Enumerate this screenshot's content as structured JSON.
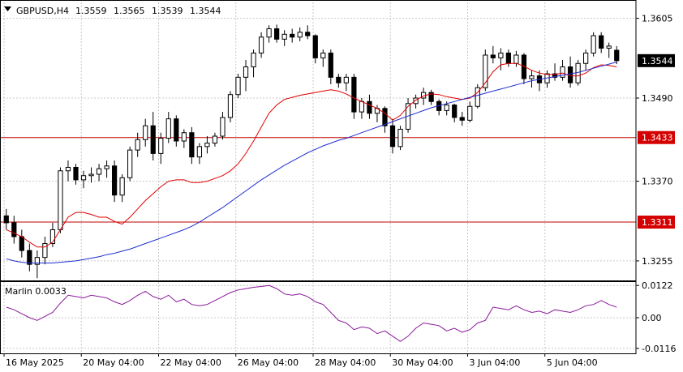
{
  "header": {
    "symbol": "GBPUSD,H4",
    "open": "1.3559",
    "high": "1.3565",
    "low": "1.3539",
    "close": "1.3544"
  },
  "indicator": {
    "label": "Marlin 0.0033"
  },
  "colors": {
    "grid": "#c8c8c8",
    "frame": "#000000",
    "ma_fast": "#e00000",
    "ma_slow": "#1f2fd0",
    "level": "#c00000",
    "oscillator": "#8b1a9b",
    "price_badge": "#000000",
    "level_badge": "#d40000"
  },
  "chart_data": [
    {
      "type": "candlestick",
      "symbol": "GBPUSD",
      "timeframe": "H4",
      "ylim": [
        1.3228,
        1.3628
      ],
      "yticks": [
        "1.3605",
        "1.3490",
        "1.3370",
        "1.3255"
      ],
      "xticks": [
        "16 May 2025",
        "20 May 04:00",
        "22 May 04:00",
        "26 May 04:00",
        "28 May 04:00",
        "30 May 04:00",
        "3 Jun 04:00",
        "5 Jun 04:00"
      ],
      "grid": true,
      "current_price": "1.3544",
      "horizontal_levels": [
        "1.3433",
        "1.3311"
      ],
      "candles": [
        [
          1.332,
          1.333,
          1.33,
          1.331
        ],
        [
          1.331,
          1.332,
          1.328,
          1.329
        ],
        [
          1.329,
          1.33,
          1.326,
          1.327
        ],
        [
          1.327,
          1.328,
          1.324,
          1.325
        ],
        [
          1.325,
          1.327,
          1.323,
          1.326
        ],
        [
          1.326,
          1.329,
          1.325,
          1.328
        ],
        [
          1.328,
          1.331,
          1.3275,
          1.33
        ],
        [
          1.33,
          1.339,
          1.3295,
          1.3385
        ],
        [
          1.3385,
          1.34,
          1.337,
          1.339
        ],
        [
          1.339,
          1.3395,
          1.3365,
          1.3372
        ],
        [
          1.3372,
          1.3385,
          1.336,
          1.3378
        ],
        [
          1.3378,
          1.339,
          1.3368,
          1.338
        ],
        [
          1.338,
          1.3395,
          1.337,
          1.3388
        ],
        [
          1.3388,
          1.34,
          1.3375,
          1.3392
        ],
        [
          1.3392,
          1.34,
          1.334,
          1.335
        ],
        [
          1.335,
          1.338,
          1.334,
          1.3375
        ],
        [
          1.3375,
          1.342,
          1.337,
          1.3415
        ],
        [
          1.3415,
          1.344,
          1.3405,
          1.343
        ],
        [
          1.343,
          1.346,
          1.342,
          1.345
        ],
        [
          1.345,
          1.347,
          1.34,
          1.341
        ],
        [
          1.341,
          1.344,
          1.3395,
          1.3432
        ],
        [
          1.3432,
          1.347,
          1.3425,
          1.346
        ],
        [
          1.346,
          1.3465,
          1.342,
          1.3428
        ],
        [
          1.3428,
          1.3445,
          1.3418,
          1.344
        ],
        [
          1.344,
          1.3448,
          1.3395,
          1.3405
        ],
        [
          1.3405,
          1.3425,
          1.3395,
          1.342
        ],
        [
          1.342,
          1.3435,
          1.341,
          1.3425
        ],
        [
          1.3425,
          1.344,
          1.342,
          1.3435
        ],
        [
          1.3435,
          1.347,
          1.343,
          1.3462
        ],
        [
          1.3462,
          1.35,
          1.3455,
          1.3495
        ],
        [
          1.3495,
          1.3525,
          1.349,
          1.352
        ],
        [
          1.352,
          1.3545,
          1.35,
          1.3535
        ],
        [
          1.3535,
          1.356,
          1.352,
          1.3555
        ],
        [
          1.3555,
          1.3585,
          1.3548,
          1.3578
        ],
        [
          1.3578,
          1.3595,
          1.357,
          1.359
        ],
        [
          1.359,
          1.3596,
          1.357,
          1.3575
        ],
        [
          1.3575,
          1.3588,
          1.3565,
          1.3582
        ],
        [
          1.3582,
          1.359,
          1.357,
          1.3578
        ],
        [
          1.3578,
          1.3592,
          1.3572,
          1.3585
        ],
        [
          1.3585,
          1.3595,
          1.3575,
          1.358
        ],
        [
          1.358,
          1.3582,
          1.354,
          1.3548
        ],
        [
          1.3548,
          1.356,
          1.3535,
          1.3555
        ],
        [
          1.3555,
          1.356,
          1.351,
          1.352
        ],
        [
          1.352,
          1.3525,
          1.3505,
          1.3512
        ],
        [
          1.3512,
          1.3525,
          1.35,
          1.352
        ],
        [
          1.352,
          1.3525,
          1.346,
          1.347
        ],
        [
          1.347,
          1.349,
          1.346,
          1.3485
        ],
        [
          1.3485,
          1.3495,
          1.346,
          1.3468
        ],
        [
          1.3468,
          1.348,
          1.3455,
          1.3475
        ],
        [
          1.3475,
          1.3478,
          1.344,
          1.345
        ],
        [
          1.345,
          1.346,
          1.341,
          1.342
        ],
        [
          1.342,
          1.345,
          1.3415,
          1.3445
        ],
        [
          1.3445,
          1.349,
          1.344,
          1.3482
        ],
        [
          1.3482,
          1.3495,
          1.3475,
          1.349
        ],
        [
          1.349,
          1.3505,
          1.348,
          1.3498
        ],
        [
          1.3498,
          1.3502,
          1.348,
          1.3485
        ],
        [
          1.3485,
          1.3488,
          1.3465,
          1.3472
        ],
        [
          1.3472,
          1.3485,
          1.3465,
          1.348
        ],
        [
          1.348,
          1.3482,
          1.3455,
          1.3462
        ],
        [
          1.3462,
          1.347,
          1.345,
          1.3458
        ],
        [
          1.3458,
          1.3485,
          1.3455,
          1.3478
        ],
        [
          1.3478,
          1.351,
          1.3475,
          1.3505
        ],
        [
          1.3505,
          1.356,
          1.35,
          1.3552
        ],
        [
          1.3552,
          1.3565,
          1.354,
          1.3548
        ],
        [
          1.3548,
          1.3562,
          1.353,
          1.3555
        ],
        [
          1.3555,
          1.356,
          1.3535,
          1.354
        ],
        [
          1.354,
          1.3558,
          1.3535,
          1.3552
        ],
        [
          1.3552,
          1.3555,
          1.351,
          1.3518
        ],
        [
          1.3518,
          1.353,
          1.3505,
          1.3522
        ],
        [
          1.3522,
          1.353,
          1.35,
          1.3512
        ],
        [
          1.3512,
          1.353,
          1.3505,
          1.3525
        ],
        [
          1.3525,
          1.354,
          1.3515,
          1.352
        ],
        [
          1.352,
          1.3545,
          1.3515,
          1.3535
        ],
        [
          1.3535,
          1.355,
          1.3505,
          1.3512
        ],
        [
          1.3512,
          1.3545,
          1.3508,
          1.354
        ],
        [
          1.354,
          1.356,
          1.353,
          1.3555
        ],
        [
          1.3555,
          1.3585,
          1.355,
          1.358
        ],
        [
          1.358,
          1.3585,
          1.3555,
          1.3562
        ],
        [
          1.3562,
          1.357,
          1.3548,
          1.3565
        ],
        [
          1.3559,
          1.3565,
          1.3539,
          1.3544
        ]
      ],
      "series": [
        {
          "values": [
            1.33,
            1.3295,
            1.329,
            1.3282,
            1.3275,
            1.3275,
            1.3282,
            1.33,
            1.3318,
            1.3325,
            1.3325,
            1.3322,
            1.3318,
            1.3318,
            1.3312,
            1.3308,
            1.3318,
            1.333,
            1.3342,
            1.3352,
            1.3362,
            1.337,
            1.3372,
            1.3372,
            1.3368,
            1.3368,
            1.337,
            1.3374,
            1.3378,
            1.3385,
            1.3395,
            1.341,
            1.3428,
            1.3448,
            1.3468,
            1.348,
            1.3488,
            1.3491,
            1.3494,
            1.3496,
            1.3498,
            1.35,
            1.3502,
            1.35,
            1.3496,
            1.349,
            1.3485,
            1.348,
            1.3475,
            1.3468,
            1.3458,
            1.3465,
            1.3478,
            1.3487,
            1.3493,
            1.3496,
            1.3495,
            1.3492,
            1.349,
            1.3488,
            1.349,
            1.3498,
            1.3512,
            1.3528,
            1.3538,
            1.354,
            1.354,
            1.3536,
            1.353,
            1.3526,
            1.3524,
            1.3524,
            1.3526,
            1.3522,
            1.3522,
            1.3526,
            1.3534,
            1.3538,
            1.3537,
            1.3535
          ]
        },
        {
          "values": [
            1.3258,
            1.3255,
            1.3253,
            1.3252,
            1.3252,
            1.3252,
            1.3252,
            1.3253,
            1.3254,
            1.3255,
            1.3257,
            1.3259,
            1.3261,
            1.3264,
            1.3266,
            1.3269,
            1.3272,
            1.3276,
            1.328,
            1.3284,
            1.3288,
            1.3292,
            1.3296,
            1.33,
            1.3305,
            1.3311,
            1.3318,
            1.3325,
            1.3332,
            1.334,
            1.3348,
            1.3356,
            1.3364,
            1.3372,
            1.3379,
            1.3386,
            1.3393,
            1.3399,
            1.3405,
            1.3411,
            1.3416,
            1.3421,
            1.3425,
            1.3429,
            1.3432,
            1.3436,
            1.344,
            1.3444,
            1.3448,
            1.3452,
            1.3456,
            1.346,
            1.3464,
            1.3468,
            1.3472,
            1.3476,
            1.3479,
            1.3482,
            1.3485,
            1.3488,
            1.3491,
            1.3494,
            1.3497,
            1.35,
            1.3503,
            1.3506,
            1.3509,
            1.3512,
            1.3515,
            1.3517,
            1.3519,
            1.3521,
            1.3523,
            1.3525,
            1.3527,
            1.353,
            1.3533,
            1.3536,
            1.3539,
            1.3542
          ]
        }
      ]
    },
    {
      "type": "line",
      "label": "Marlin 0.0033",
      "ylim": [
        -0.0135,
        0.0135
      ],
      "yticks": [
        "0.0122",
        "0.00",
        "-0.0116"
      ],
      "series": [
        {
          "name": "Marlin",
          "values": [
            0.004,
            0.003,
            0.0015,
            0.0,
            -0.001,
            0.0005,
            0.002,
            0.0055,
            0.0085,
            0.008,
            0.0075,
            0.0085,
            0.008,
            0.0075,
            0.006,
            0.005,
            0.0065,
            0.0085,
            0.01,
            0.008,
            0.007,
            0.0085,
            0.006,
            0.007,
            0.005,
            0.0045,
            0.005,
            0.0065,
            0.008,
            0.0095,
            0.0105,
            0.011,
            0.0115,
            0.0118,
            0.0122,
            0.011,
            0.009,
            0.0085,
            0.009,
            0.008,
            0.006,
            0.005,
            0.002,
            -0.001,
            -0.002,
            -0.0045,
            -0.0035,
            -0.004,
            -0.006,
            -0.005,
            -0.007,
            -0.009,
            -0.007,
            -0.004,
            -0.002,
            -0.0025,
            -0.003,
            -0.005,
            -0.004,
            -0.0055,
            -0.0045,
            -0.002,
            -0.001,
            0.004,
            0.0035,
            0.003,
            0.0045,
            0.003,
            0.002,
            0.0025,
            0.0015,
            0.003,
            0.0025,
            0.002,
            0.003,
            0.0045,
            0.005,
            0.0065,
            0.005,
            0.004
          ]
        }
      ]
    }
  ]
}
